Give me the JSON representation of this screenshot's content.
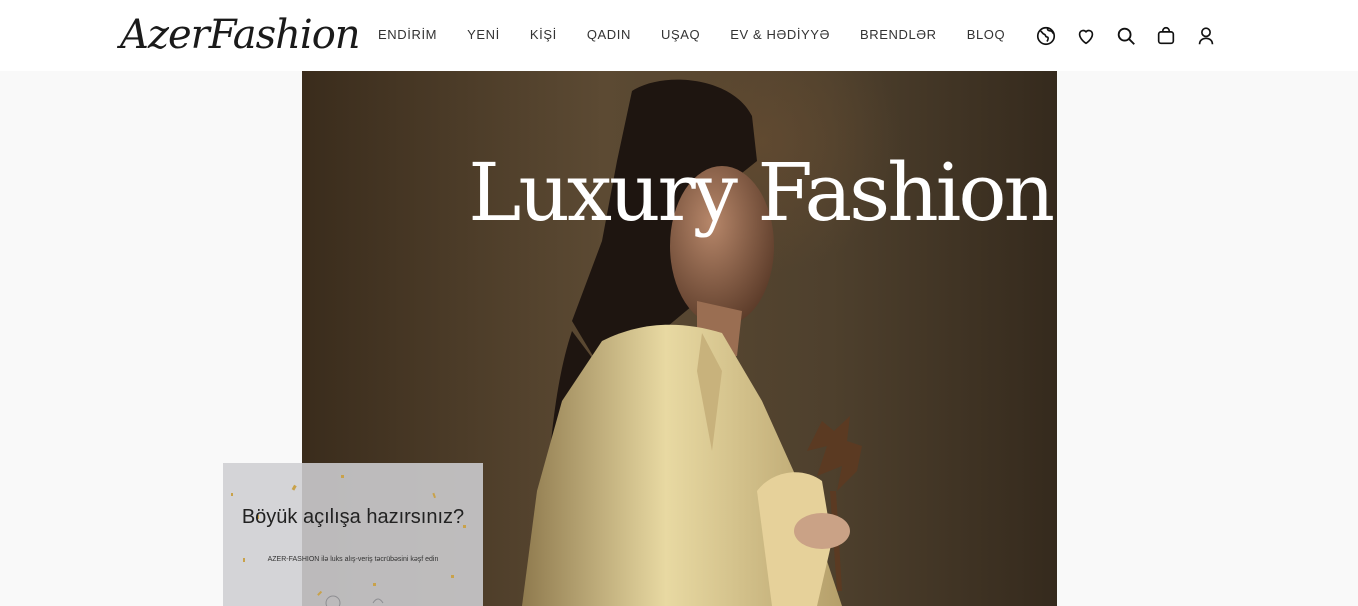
{
  "brand": {
    "logo_text": "AzerFashion"
  },
  "nav": {
    "items": [
      {
        "label": "ENDİRİM"
      },
      {
        "label": "YENİ"
      },
      {
        "label": "KİŞİ"
      },
      {
        "label": "QADIN"
      },
      {
        "label": "UŞAQ"
      },
      {
        "label": "EV & HƏDİYYƏ"
      },
      {
        "label": "BRENDLƏR"
      },
      {
        "label": "BLOQ"
      }
    ]
  },
  "header_icons": [
    "globe-icon",
    "heart-icon",
    "search-icon",
    "shopping-bag-icon",
    "user-icon"
  ],
  "hero": {
    "title": "Luxury Fashion"
  },
  "promo": {
    "title": "Böyük açılışa hazırsınız?",
    "subtitle": "AZER-FASHION ilə luks alış-veriş təcrübəsini kəşf edin"
  },
  "colors": {
    "text": "#333333",
    "page_bg": "#f9f9f9",
    "header_bg": "#ffffff",
    "hero_title": "#ffffff"
  }
}
